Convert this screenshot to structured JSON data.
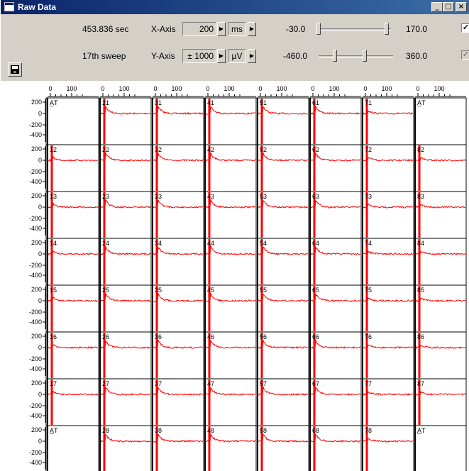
{
  "window": {
    "title": "Raw Data"
  },
  "toolbar": {
    "time_readout": "453.836 sec",
    "sweep_readout": "17th sweep",
    "xaxis": {
      "label": "X-Axis",
      "value": "200",
      "unit": "ms",
      "range_min": "-30.0",
      "range_max": "170.0"
    },
    "yaxis": {
      "label": "Y-Axis",
      "value": "± 1000",
      "unit": "µV",
      "range_min": "-460.0",
      "range_max": "360.0"
    },
    "x_checkbox_checked": true,
    "y_checkbox_checked": true
  },
  "grid": {
    "x_tick_labels": [
      "0",
      "100"
    ],
    "y_tick_labels": [
      "200",
      "0",
      "-200",
      "-400"
    ],
    "columns": 8,
    "rows": 8,
    "trace_color": "#ff0000",
    "channels": [
      [
        "A̲T",
        "21",
        "31",
        "41",
        "51",
        "61",
        "71",
        "A̲T"
      ],
      [
        "12",
        "22",
        "32",
        "42",
        "52",
        "62",
        "72",
        "82"
      ],
      [
        "13",
        "23",
        "33",
        "43",
        "53",
        "63",
        "73",
        "83"
      ],
      [
        "14",
        "24",
        "34",
        "44",
        "54",
        "64",
        "74",
        "84"
      ],
      [
        "15",
        "25",
        "35",
        "45",
        "55",
        "65",
        "75",
        "85"
      ],
      [
        "16",
        "26",
        "36",
        "46",
        "56",
        "66",
        "76",
        "86"
      ],
      [
        "17",
        "27",
        "37",
        "47",
        "57",
        "67",
        "77",
        "87"
      ],
      [
        "A̲T",
        "28",
        "38",
        "48",
        "58",
        "68",
        "78",
        "A̲T"
      ]
    ]
  }
}
